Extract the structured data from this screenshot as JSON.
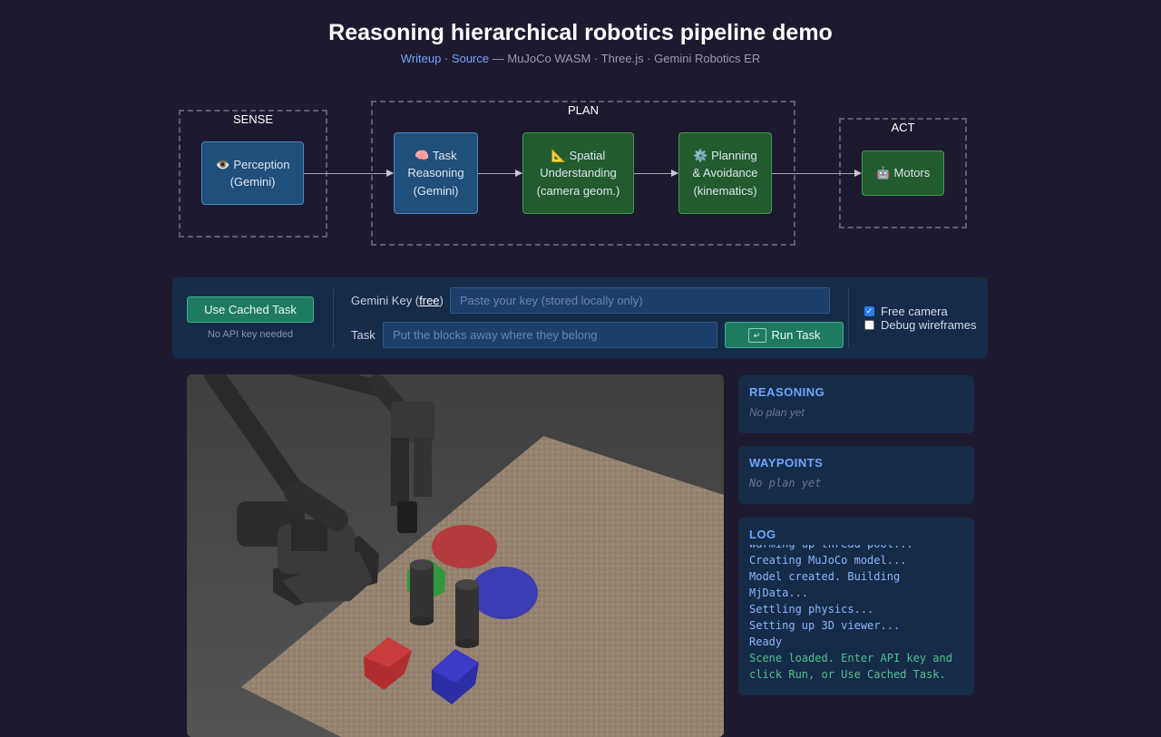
{
  "header": {
    "title": "Reasoning hierarchical robotics pipeline demo",
    "links": {
      "writeup": "Writeup",
      "sep": "·",
      "source": "Source"
    },
    "tech": "— MuJoCo WASM · Three.js · Gemini Robotics ER"
  },
  "pipeline": {
    "groups": {
      "sense": "SENSE",
      "plan": "PLAN",
      "act": "ACT"
    },
    "nodes": {
      "perception": {
        "icon": "👁️",
        "line1": "Perception",
        "line2": "(Gemini)"
      },
      "task_reasoning": {
        "icon": "🧠",
        "line1": "Task",
        "line2": "Reasoning",
        "line3": "(Gemini)"
      },
      "spatial": {
        "icon": "📐",
        "line1": "Spatial",
        "line2": "Understanding",
        "line3": "(camera geom.)"
      },
      "planning": {
        "icon": "⚙️",
        "line1": "Planning",
        "line2": "& Avoidance",
        "line3": "(kinematics)"
      },
      "motors": {
        "icon": "🤖",
        "line1": "Motors"
      }
    }
  },
  "controls": {
    "cached_button": "Use Cached Task",
    "cached_hint": "No API key needed",
    "key_label": "Gemini Key (",
    "key_link": "free",
    "key_label_end": ")",
    "key_placeholder": "Paste your key (stored locally only)",
    "task_label": "Task",
    "task_placeholder": "Put the blocks away where they belong",
    "run_icon": "↵",
    "run_button": "Run Task",
    "free_camera": {
      "label": "Free camera",
      "checked": true
    },
    "debug_wireframes": {
      "label": "Debug wireframes",
      "checked": false
    }
  },
  "panels": {
    "reasoning": {
      "title": "REASONING",
      "empty": "No plan yet"
    },
    "waypoints": {
      "title": "WAYPOINTS",
      "empty": "No plan yet"
    },
    "log": {
      "title": "LOG",
      "lines": [
        {
          "text": "Warming up thread pool...",
          "status": "info"
        },
        {
          "text": "Creating MuJoCo model...",
          "status": "info"
        },
        {
          "text": "Model created. Building",
          "status": "info"
        },
        {
          "text": "MjData...",
          "status": "info"
        },
        {
          "text": "Settling physics...",
          "status": "info"
        },
        {
          "text": "Setting up 3D viewer...",
          "status": "info"
        },
        {
          "text": "Ready",
          "status": "info"
        },
        {
          "text": "Scene loaded. Enter API key and",
          "status": "ok"
        },
        {
          "text": "click Run, or Use Cached Task.",
          "status": "ok"
        }
      ]
    }
  },
  "colors": {
    "background": "#1d1a2f",
    "panel": "#162b48",
    "accent": "#6fa3ff",
    "button": "#1f7a62",
    "node_blue": "#1f4f7a",
    "node_green": "#215b2e",
    "log_ok": "#4cc38a"
  }
}
